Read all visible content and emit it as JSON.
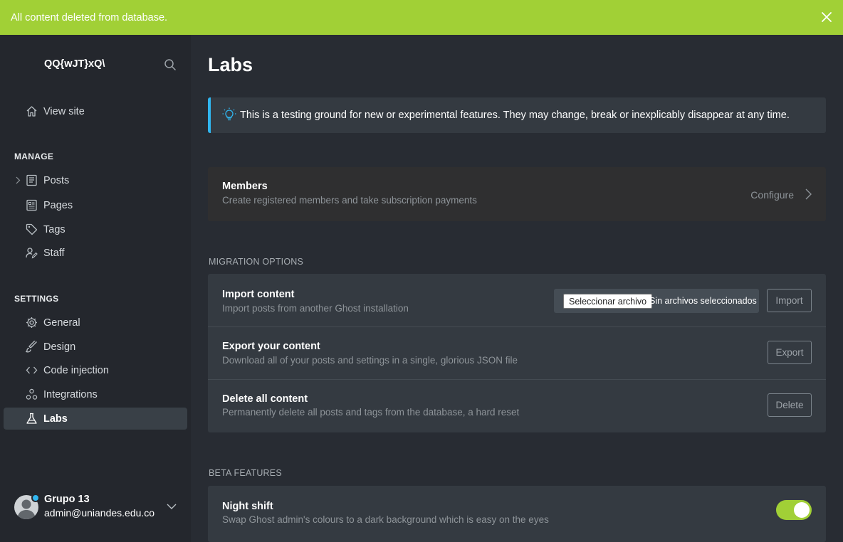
{
  "notification": {
    "message": "All content deleted from database."
  },
  "sidebar": {
    "blog_title": "QQ{wJT}xQ\\",
    "view_site": "View site",
    "manage_header": "MANAGE",
    "manage_items": [
      {
        "label": "Posts",
        "icon": "posts-icon"
      },
      {
        "label": "Pages",
        "icon": "pages-icon"
      },
      {
        "label": "Tags",
        "icon": "tag-icon"
      },
      {
        "label": "Staff",
        "icon": "staff-icon"
      }
    ],
    "settings_header": "SETTINGS",
    "settings_items": [
      {
        "label": "General",
        "icon": "gear-icon"
      },
      {
        "label": "Design",
        "icon": "brush-icon"
      },
      {
        "label": "Code injection",
        "icon": "code-icon"
      },
      {
        "label": "Integrations",
        "icon": "integrations-icon"
      },
      {
        "label": "Labs",
        "icon": "flask-icon",
        "active": true
      }
    ],
    "user": {
      "name": "Grupo 13",
      "email": "admin@uniandes.edu.co"
    }
  },
  "main": {
    "title": "Labs",
    "info_text": "This is a testing ground for new or experimental features. They may change, break or inexplicably disappear at any time.",
    "members": {
      "title": "Members",
      "description": "Create registered members and take subscription payments",
      "action": "Configure"
    },
    "migration": {
      "header": "MIGRATION OPTIONS",
      "import": {
        "title": "Import content",
        "description": "Import posts from another Ghost installation",
        "file_button": "Seleccionar archivo",
        "file_status": "Sin archivos seleccionados",
        "button": "Import"
      },
      "export": {
        "title": "Export your content",
        "description": "Download all of your posts and settings in a single, glorious JSON file",
        "button": "Export"
      },
      "delete": {
        "title": "Delete all content",
        "description": "Permanently delete all posts and tags from the database, a hard reset",
        "button": "Delete"
      }
    },
    "beta": {
      "header": "BETA FEATURES",
      "night_shift": {
        "title": "Night shift",
        "description": "Swap Ghost admin's colours to a dark background which is easy on the eyes",
        "enabled": true
      }
    }
  },
  "colors": {
    "accent_green": "#a1d036",
    "info_blue": "#30b6f0"
  }
}
